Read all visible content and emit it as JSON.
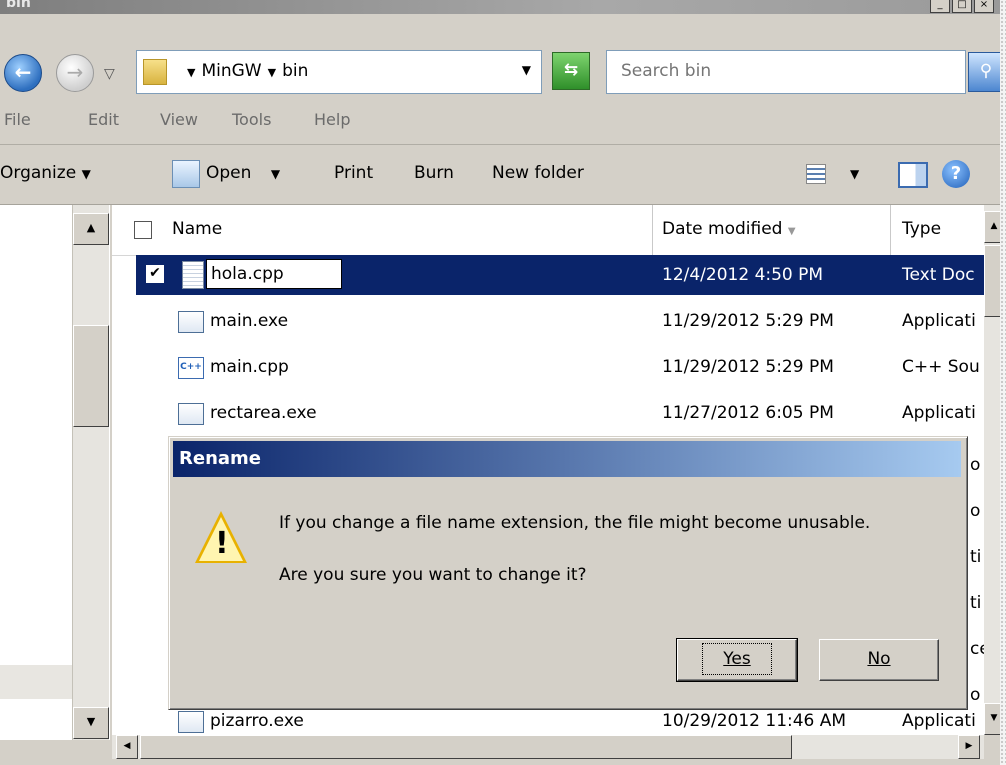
{
  "window": {
    "title": "bin"
  },
  "address": {
    "crumbs": [
      "MinGW",
      "bin"
    ],
    "search_placeholder": "Search bin"
  },
  "menu": {
    "items": [
      "File",
      "Edit",
      "View",
      "Tools",
      "Help"
    ]
  },
  "toolbar": {
    "organize": "Organize",
    "open": "Open",
    "print": "Print",
    "burn": "Burn",
    "new_folder": "New folder"
  },
  "columns": {
    "name": "Name",
    "date": "Date modified",
    "type": "Type"
  },
  "files": [
    {
      "name": "hola.cpp",
      "date": "12/4/2012 4:50 PM",
      "type": "Text Doc",
      "icon": "text-file-icon",
      "selected": true
    },
    {
      "name": "main.exe",
      "date": "11/29/2012 5:29 PM",
      "type": "Applicati",
      "icon": "exe-file-icon"
    },
    {
      "name": "main.cpp",
      "date": "11/29/2012 5:29 PM",
      "type": "C++ Sou",
      "icon": "cpp-file-icon"
    },
    {
      "name": "rectarea.exe",
      "date": "11/27/2012 6:05 PM",
      "type": "Applicati",
      "icon": "exe-file-icon"
    },
    {
      "name": "pizarro.exe",
      "date": "10/29/2012 11:46 AM",
      "type": "Applicati",
      "icon": "exe-file-icon"
    }
  ],
  "type_fragments": [
    "o",
    "o",
    "ti",
    "ti",
    "ce",
    "o"
  ],
  "dialog": {
    "title": "Rename",
    "message": "If you change a file name extension, the file might become unusable.",
    "question": "Are you sure you want to change it?",
    "yes_label": "Yes",
    "no_label": "No"
  },
  "colors": {
    "selection": "#0a246a",
    "dialog_title_start": "#0a246a",
    "dialog_title_end": "#a6caf0",
    "chrome": "#d4d0c8"
  }
}
